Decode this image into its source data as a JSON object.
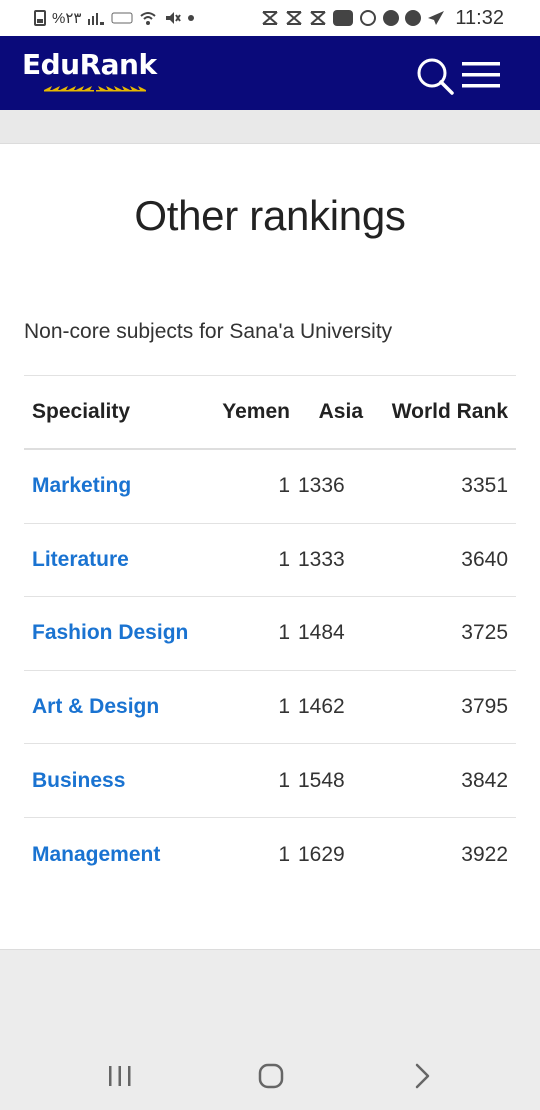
{
  "status_bar": {
    "battery_text": "%٢٣",
    "time": "11:32"
  },
  "header": {
    "logo_text": "EduRank",
    "search_icon": "search-icon",
    "menu_icon": "hamburger-menu-icon"
  },
  "card": {
    "title": "Other rankings",
    "subtitle": "Non-core subjects for Sana'a University"
  },
  "table": {
    "headers": {
      "speciality": "Speciality",
      "yemen": "Yemen",
      "asia": "Asia",
      "world": "World Rank"
    },
    "rows": [
      {
        "speciality": "Marketing",
        "yemen": "1",
        "asia": "1336",
        "world": "3351"
      },
      {
        "speciality": "Literature",
        "yemen": "1",
        "asia": "1333",
        "world": "3640"
      },
      {
        "speciality": "Fashion Design",
        "yemen": "1",
        "asia": "1484",
        "world": "3725"
      },
      {
        "speciality": "Art & Design",
        "yemen": "1",
        "asia": "1462",
        "world": "3795"
      },
      {
        "speciality": "Business",
        "yemen": "1",
        "asia": "1548",
        "world": "3842"
      },
      {
        "speciality": "Management",
        "yemen": "1",
        "asia": "1629",
        "world": "3922"
      }
    ]
  },
  "colors": {
    "header_bg": "#0a0a7a",
    "link": "#1a73d1",
    "wreath": "#e6b800"
  }
}
